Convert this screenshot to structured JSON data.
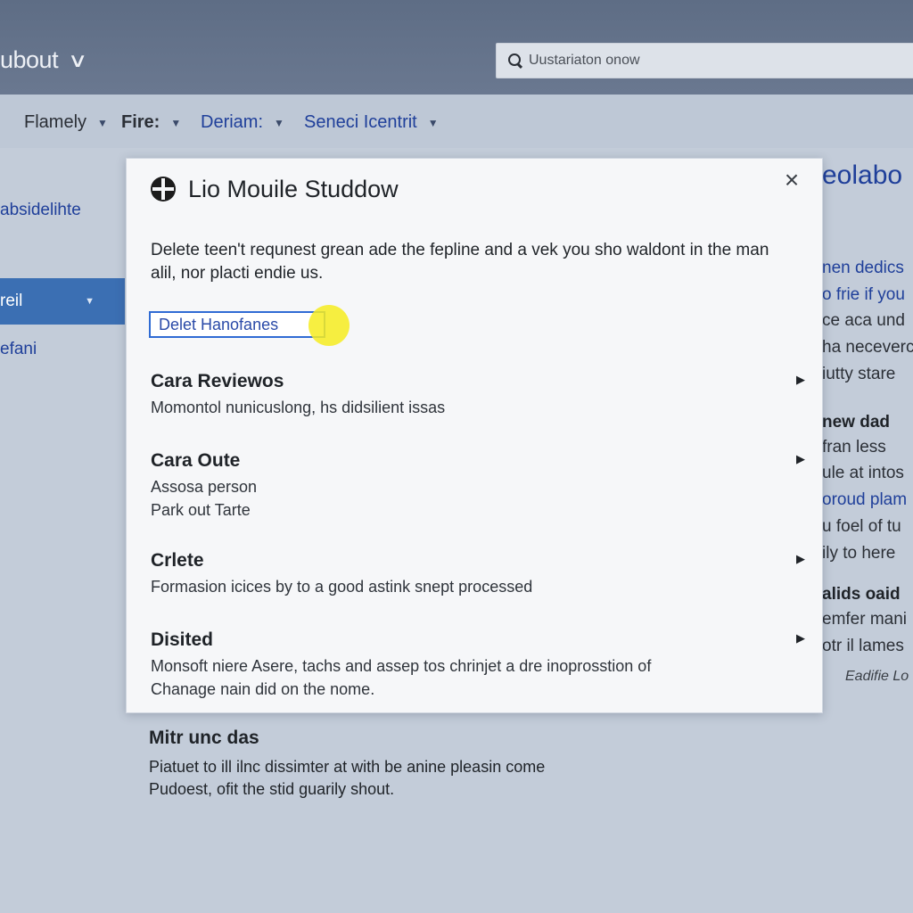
{
  "app": {
    "title": "ubout"
  },
  "search": {
    "placeholder": "Uustariaton onow"
  },
  "nav": [
    {
      "label": "Flamely"
    },
    {
      "label": "Fire:"
    },
    {
      "label": "Deriam:"
    },
    {
      "label": "Seneci Icentrit"
    }
  ],
  "sidebar": {
    "items": [
      {
        "label": "absidelihte"
      },
      {
        "label": "reil"
      },
      {
        "label": "efani"
      }
    ]
  },
  "right_column": {
    "title": "eolabo",
    "lines": [
      "nen dedics",
      "o frie if you",
      "ce aca und",
      "ha neceverc",
      "iutty stare",
      "new dad",
      "fran less",
      "ule at intos",
      "oroud plam",
      "u foel of tu",
      "ily to here",
      "alids oaid",
      "emfer mani",
      "otr il lames",
      "Eadifie Lo"
    ]
  },
  "background": {
    "heading": "Mitr unc das",
    "lines": [
      "Piatuet to ill ilnc dissimter at with be anine pleasin come",
      "Pudoest, ofit the stid guarily shout."
    ]
  },
  "dialog": {
    "title": "Lio Mouile Studdow",
    "close_label": "×",
    "description": "Delete teen't requnest grean ade the fepline and a vek you sho waldont in the man alil, nor placti endie us.",
    "input_value": "Delet Hanofanes",
    "sections": [
      {
        "title": "Cara Reviewos",
        "lines": [
          "Momontol nunicuslong, hs didsilient issas"
        ]
      },
      {
        "title": "Cara Oute",
        "lines": [
          "Assosa person",
          "Park out Tarte"
        ]
      },
      {
        "title": "Crlete",
        "lines": [
          "Formasion icices by to a good astink snept processed"
        ]
      },
      {
        "title": "Disited",
        "lines": [
          "Monsoft niere Asere, tachs and assep tos chrinjet a dre inoprosstion of",
          "Chanage nain did on the nome."
        ]
      }
    ]
  },
  "colors": {
    "topbar": "#5e6d85",
    "accent_blue": "#1f3f9a",
    "sidebar_active": "#3b6fb3",
    "input_border": "#2f6bd4",
    "cursor_highlight": "#f6ec20"
  }
}
